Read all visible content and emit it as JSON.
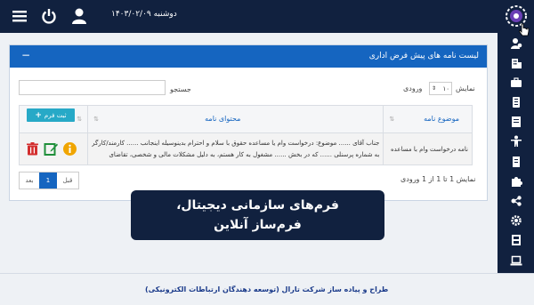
{
  "header": {
    "date": "دوشنبه ۱۴۰۳/۰۲/۰۹",
    "icons": [
      "menu-icon",
      "power-icon",
      "user-icon"
    ],
    "logo": "org-logo"
  },
  "sidebar": {
    "items": [
      "user-management-icon",
      "building-icon",
      "briefcase-icon",
      "archive-icon",
      "folder-icon",
      "person-icon",
      "document-icon",
      "puzzle-icon",
      "network-icon",
      "gear-icon",
      "film-icon",
      "laptop-icon"
    ]
  },
  "panel": {
    "title": "لیست نامه های پیش فرض اداری",
    "collapse": "−",
    "show_label": "نمایش",
    "show_value": "۱۰",
    "entries_label": "ورودی",
    "search_label": "جستجو",
    "search_value": "",
    "columns": {
      "subject": "موضوع نامه",
      "content": "محتوای نامه"
    },
    "add_button": "ثبت فرم",
    "rows": [
      {
        "subject": "نامه درخواست وام با مساعده",
        "content_line1": "جناب آقای ...... موضوع: درخواست وام یا مساعده حقوق با سلام و احترام بدینوسیله اینجانب ...... کارمند/کارگر",
        "content_line2": "به شماره پرسنلی ...... که در بخش ...... مشغول به کار هستم، به دلیل مشکلات مالی و شخصی، تقاضای"
      }
    ],
    "info_text": "نمایش 1 تا 1 از 1 ورودی",
    "pager": {
      "prev": "قبل",
      "page": "1",
      "next": "بعد"
    }
  },
  "banner": {
    "line1": "فرم‌های سازمانی دیجیتال،",
    "line2": "فرم‌ساز آنلاین"
  },
  "footer": {
    "text": "طراح و پیاده ساز شرکت تارال (توسعه دهندگان ارتباطات الکترونیکی)"
  },
  "colors": {
    "navy": "#11213f",
    "primary": "#1565c0",
    "info": "#27a9c7",
    "warn": "#f0a500",
    "edit": "#1f8f3a",
    "danger": "#d32f2f"
  }
}
